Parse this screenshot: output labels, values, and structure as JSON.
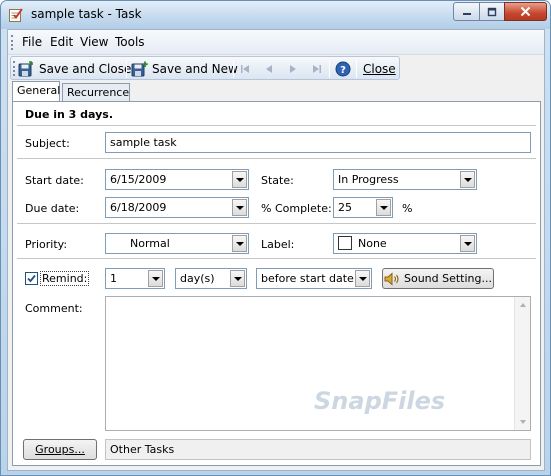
{
  "window": {
    "title": "sample task - Task",
    "controls": {
      "minimize": "minimize",
      "maximize": "maximize",
      "close": "close"
    }
  },
  "menubar": {
    "items": [
      {
        "label": "File"
      },
      {
        "label": "Edit"
      },
      {
        "label": "View"
      },
      {
        "label": "Tools"
      }
    ]
  },
  "toolbar": {
    "save_and_close": "Save and Close",
    "save_and_new": "Save and New",
    "close": "Close",
    "icons": [
      "save-close-icon",
      "save-new-icon",
      "first-record-icon",
      "previous-record-icon",
      "next-record-icon",
      "last-record-icon",
      "help-icon"
    ]
  },
  "tabs": [
    {
      "label": "General",
      "active": true
    },
    {
      "label": "Recurrence",
      "active": false
    }
  ],
  "general": {
    "due_notice": "Due in 3 days.",
    "subject": {
      "label": "Subject:",
      "value": "sample task"
    },
    "start_date": {
      "label": "Start date:",
      "value": "6/15/2009"
    },
    "due_date": {
      "label": "Due date:",
      "value": "6/18/2009"
    },
    "state": {
      "label": "State:",
      "value": "In Progress"
    },
    "percent_complete": {
      "label": "% Complete:",
      "value": "25",
      "unit": "%"
    },
    "priority": {
      "label": "Priority:",
      "value": "Normal"
    },
    "label": {
      "label": "Label:",
      "value": "None"
    },
    "remind": {
      "label": "Remind:",
      "checked": true,
      "amount": "1",
      "unit": "day(s)",
      "relative": "before start date",
      "sound_button": "Sound Setting..."
    },
    "comment": {
      "label": "Comment:",
      "value": ""
    },
    "groups": {
      "button": "Groups...",
      "value": "Other Tasks"
    }
  },
  "watermark": "SnapFiles",
  "colors": {
    "window_frame": "#b9d3ea",
    "panel_bg": "#ffffff",
    "close_button": "#c7472f",
    "field_border": "#7f9db9"
  }
}
